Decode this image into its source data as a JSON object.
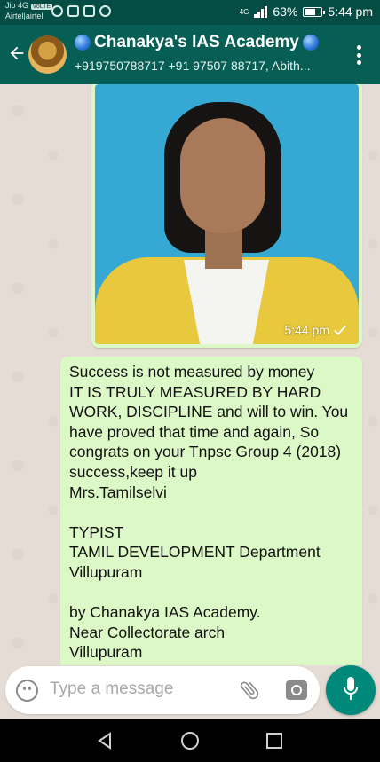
{
  "status_bar": {
    "carrier_line1": "Jio 4G",
    "carrier_badge": "VoLTE",
    "carrier_line2": "Airtel|airtel",
    "network": "4G",
    "battery": "63%",
    "time": "5:44 pm"
  },
  "header": {
    "title": "Chanakya's IAS Academy",
    "subtitle": "+919750788717 +91 97507 88717, Abith..."
  },
  "messages": {
    "image_time": "5:44 pm",
    "text": "Success is not measured by money\nIT IS TRULY MEASURED BY HARD WORK, DISCIPLINE and will to win. You have proved that time and again, So congrats on your Tnpsc Group 4 (2018) success,keep it up\nMrs.Tamilselvi\n\nTYPIST\nTAMIL DEVELOPMENT Department\nVillupuram\n\nby Chanakya IAS Academy.\nNear Collectorate arch\nVillupuram"
  },
  "input": {
    "placeholder": "Type a message"
  },
  "icons": {
    "back": "arrow-left-icon",
    "menu": "more-vert-icon",
    "emoji": "emoji-icon",
    "attach": "paperclip-icon",
    "camera": "camera-icon",
    "mic": "mic-icon"
  },
  "colors": {
    "header": "#075e54",
    "status_bar": "#054d44",
    "outgoing_bubble": "#dcf8c6",
    "chat_bg": "#e5ddd5",
    "fab": "#00897b"
  }
}
